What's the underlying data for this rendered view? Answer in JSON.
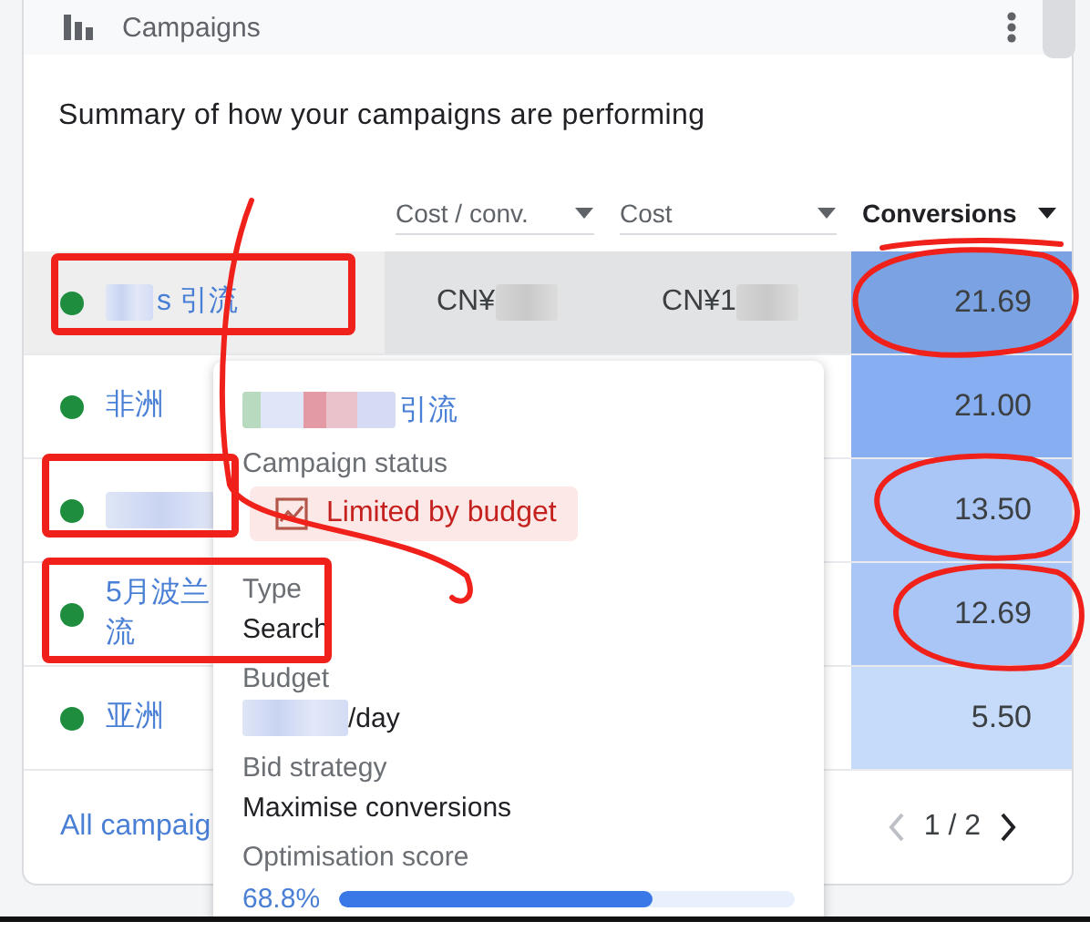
{
  "card": {
    "title": "Campaigns",
    "summary": "Summary of how your campaigns are performing"
  },
  "table": {
    "columns": [
      {
        "label": "Cost / conv.",
        "sorted": false
      },
      {
        "label": "Cost",
        "sorted": false
      },
      {
        "label": "Conversions",
        "sorted": true
      }
    ],
    "rows": [
      {
        "name": {
          "lines": [
            "s 引流"
          ],
          "redacted": true
        },
        "cost_per_conv": {
          "text": "CN¥",
          "redacted": true
        },
        "cost": {
          "text": "CN¥1",
          "redacted": true
        },
        "conversions": "21.69",
        "color": "#7ba3e3",
        "highlighted": true
      },
      {
        "name": {
          "lines": [
            "非洲"
          ]
        },
        "conversions": "21.00",
        "color": "#86aef0",
        "highlighted": false
      },
      {
        "name": {
          "redacted": true
        },
        "conversions": "13.50",
        "color": "#a9c6f6",
        "highlighted": false
      },
      {
        "name": {
          "lines": [
            "5月波兰",
            "流"
          ]
        },
        "conversions": "12.69",
        "color": "#a9c6f6",
        "highlighted": false
      },
      {
        "name": {
          "lines": [
            "亚洲"
          ]
        },
        "conversions": "5.50",
        "color": "#c6daf9",
        "highlighted": false
      }
    ]
  },
  "footer": {
    "link": "All campaig",
    "pager": "1 / 2"
  },
  "tooltip": {
    "title": {
      "text": "引流",
      "redacted": true
    },
    "fields": [
      {
        "kind": "status",
        "label": "Campaign status",
        "value": "Limited by budget"
      },
      {
        "kind": "text",
        "label": "Type",
        "value": "Search"
      },
      {
        "kind": "text",
        "label": "Budget",
        "value": "/day",
        "redacted": true
      },
      {
        "kind": "text",
        "label": "Bid strategy",
        "value": "Maximise conversions"
      },
      {
        "kind": "score",
        "label": "Optimisation score",
        "value": "68.8%",
        "level": 0.688
      }
    ]
  },
  "annotations": [
    {
      "kind": "box"
    },
    {
      "kind": "box"
    },
    {
      "kind": "box"
    },
    {
      "kind": "circle"
    },
    {
      "kind": "circle"
    },
    {
      "kind": "circle"
    },
    {
      "kind": "underline"
    },
    {
      "kind": "scribble"
    }
  ]
}
